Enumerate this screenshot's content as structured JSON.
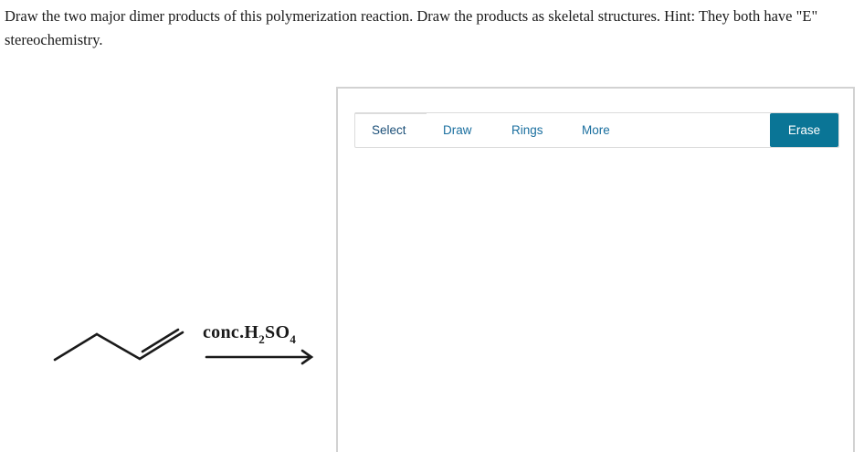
{
  "question": {
    "text": "Draw the two major dimer products of this polymerization reaction. Draw the products as skeletal structures. Hint: They both have \"E\" stereochemistry."
  },
  "reaction": {
    "reagent_prefix": "conc.H",
    "reagent_sub1": "2",
    "reagent_mid": "SO",
    "reagent_sub2": "4"
  },
  "toolbar": {
    "select_label": "Select",
    "draw_label": "Draw",
    "rings_label": "Rings",
    "more_label": "More",
    "erase_label": "Erase"
  },
  "colors": {
    "accent": "#0a7596",
    "tool_text": "#1a6f9f",
    "panel_border": "#d2d2d2"
  }
}
